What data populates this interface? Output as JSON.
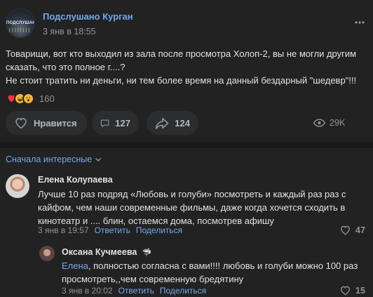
{
  "post": {
    "group_name": "Подслушано Курган",
    "avatar_text": "ПОДСЛУШАНО",
    "date": "3 янв в 18:55",
    "text_lines": [
      "Товарищи, вот кто выходил из зала после просмотра Холоп-2, вы не могли другим",
      "сказать, что это полное г....?",
      "Не стоит тратить ни деньги, ни тем более время на данный бездарный \"шедевр\"!!!"
    ],
    "reactions": [
      "heart",
      "laugh",
      "wow"
    ],
    "reactions_count": "160",
    "like_label": "Нравится",
    "comments_count": "127",
    "shares_count": "124",
    "views": "29K"
  },
  "comments": {
    "sort_label": "Сначала интересные",
    "items": [
      {
        "author": "Елена Колупаева",
        "text_lines": [
          "Лучше 10 раз подряд «Любовь и голуби» посмотреть и каждый раз раз с",
          "кайфом, чем наши современные фильмы, даже когда хочется сходить в",
          "кинотеатр и .... блин, остаемся дома, посмотрев афишу"
        ],
        "date": "3 янв в 19:57",
        "reply_label": "Ответить",
        "share_label": "Поделиться",
        "likes": "47"
      },
      {
        "author": "Оксана Кучмеева",
        "author_badge": "🦈",
        "mention": "Елена",
        "text_first": ", полностью согласна с вами!!!! любовь и голуби можно 100 раз",
        "text_second": "просмотреть,,чем современную бредятину",
        "date": "3 янв в 20:02",
        "reply_label": "Ответить",
        "share_label": "Поделиться",
        "likes": "15"
      }
    ]
  },
  "colors": {
    "background": "#19191a",
    "card": "#222222",
    "accent": "#71aaeb",
    "muted": "#939393",
    "text": "#e1e3e6"
  }
}
